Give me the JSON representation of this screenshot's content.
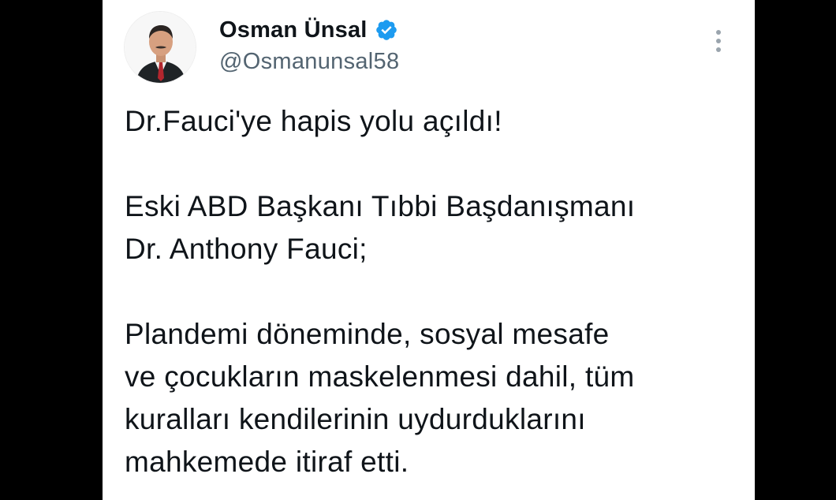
{
  "tweet": {
    "author": {
      "display_name": "Osman Ünsal",
      "handle": "@Osmanunsal58",
      "verified": true,
      "avatar_icon": "profile-photo"
    },
    "more_icon": "more-vertical-icon",
    "colors": {
      "verified_badge": "#1d9bf0",
      "handle": "#536471",
      "text": "#0f1419"
    },
    "paragraphs": [
      {
        "lines": [
          "Dr.Fauci'ye hapis yolu açıldı!"
        ]
      },
      {
        "lines": [
          "Eski ABD Başkanı Tıbbi Başdanışmanı",
          "Dr. Anthony Fauci;"
        ]
      },
      {
        "lines": [
          "Plandemi döneminde, sosyal mesafe",
          "ve çocukların maskelenmesi dahil, tüm",
          "kuralları kendilerinin uydurduklarını",
          "mahkemede itiraf etti."
        ]
      }
    ]
  }
}
